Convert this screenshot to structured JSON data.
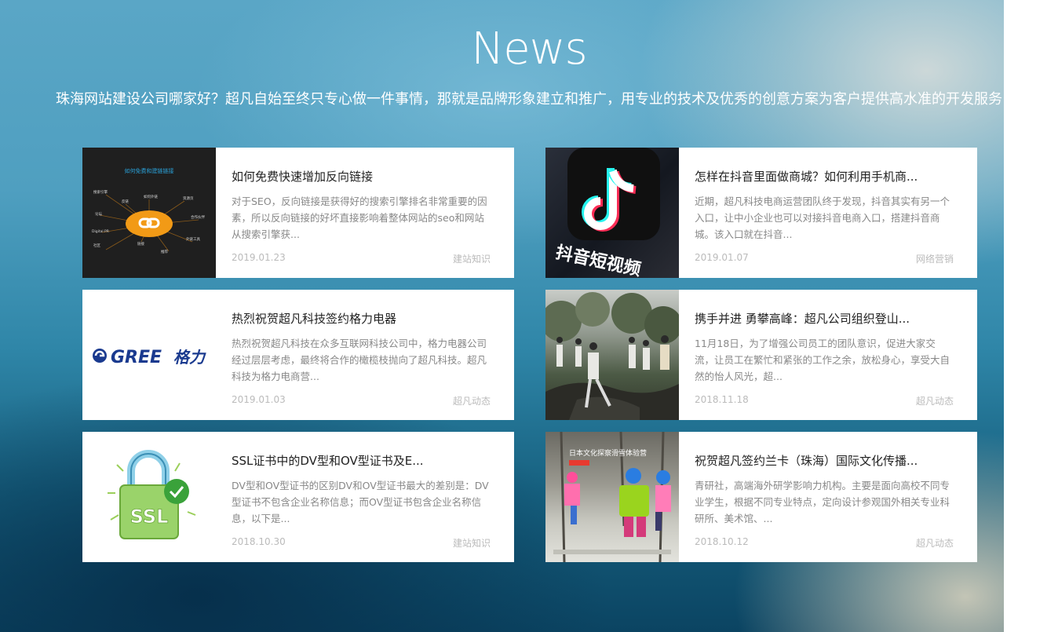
{
  "section": {
    "title": "News",
    "subtitle": "珠海网站建设公司哪家好？超凡自始至终只专心做一件事情，那就是品牌形象建立和推广，用专业的技术及优秀的创意方案为客户提供高水准的开发服务"
  },
  "articles": [
    {
      "title": "如何免费快速增加反向链接",
      "desc": "对于SEO，反向链接是获得好的搜索引擎排名非常重要的因素，所以反向链接的好坏直接影响着整体网站的seo和网站从搜索引擎获...",
      "date": "2019.01.23",
      "category": "建站知识",
      "thumb": {
        "kind": "diagram",
        "caption": "如何免费和建链链接",
        "center": "backlink-chain-icon",
        "nodes": [
          "搜索引擎",
          "反链",
          "如何外链",
          "Digital PR",
          "论坛",
          "社区",
          "资源页",
          "合作伙伴",
          "链接",
          "外部",
          "外链工具",
          "推荐"
        ]
      }
    },
    {
      "title": "怎样在抖音里面做商城？如何利用手机商...",
      "desc": "近期，超凡科技电商运营团队终于发现，抖音其实有另一个入口，让中小企业也可以对接抖音电商入口，搭建抖音商城。该入口就在抖音...",
      "date": "2019.01.07",
      "category": "网络营销",
      "thumb": {
        "kind": "douyin",
        "caption": "抖音短视频",
        "icon": "douyin-note-icon"
      }
    },
    {
      "title": "热烈祝贺超凡科技签约格力电器",
      "desc": "热烈祝贺超凡科技在众多互联网科技公司中，格力电器公司经过层层考虑，最终将合作的橄榄枝抛向了超凡科技。超凡科技为格力电商营...",
      "date": "2019.01.03",
      "category": "超凡动态",
      "thumb": {
        "kind": "gree",
        "caption": "GREE格力",
        "icon": "gree-logo-icon"
      }
    },
    {
      "title": "携手并进 勇攀高峰：超凡公司组织登山...",
      "desc": "11月18日，为了增强公司员工的团队意识，促进大家交流，让员工在繁忙和紧张的工作之余，放松身心，享受大自然的怡人风光，超...",
      "date": "2018.11.18",
      "category": "超凡动态",
      "thumb": {
        "kind": "photo",
        "caption": "",
        "icon": "hiking-photo-icon"
      }
    },
    {
      "title": "SSL证书中的DV型和OV型证书及E...",
      "desc": "DV型和OV型证书的区别DV和OV型证书最大的差别是：DV型证书不包含企业名称信息；而OV型证书包含企业名称信息，以下是...",
      "date": "2018.10.30",
      "category": "建站知识",
      "thumb": {
        "kind": "ssl",
        "caption": "SSL",
        "icon": "ssl-lock-icon"
      }
    },
    {
      "title": "祝贺超凡签约兰卡（珠海）国际文化传播...",
      "desc": "青研社，高端海外研学影响力机构。主要是面向高校不同专业学生，根据不同专业特点，定向设计参观国外相关专业科研所、美术馆、...",
      "date": "2018.10.12",
      "category": "超凡动态",
      "thumb": {
        "kind": "ski",
        "caption": "日本文化探察滑雪体验营",
        "icon": "ski-kids-photo-icon"
      }
    }
  ]
}
